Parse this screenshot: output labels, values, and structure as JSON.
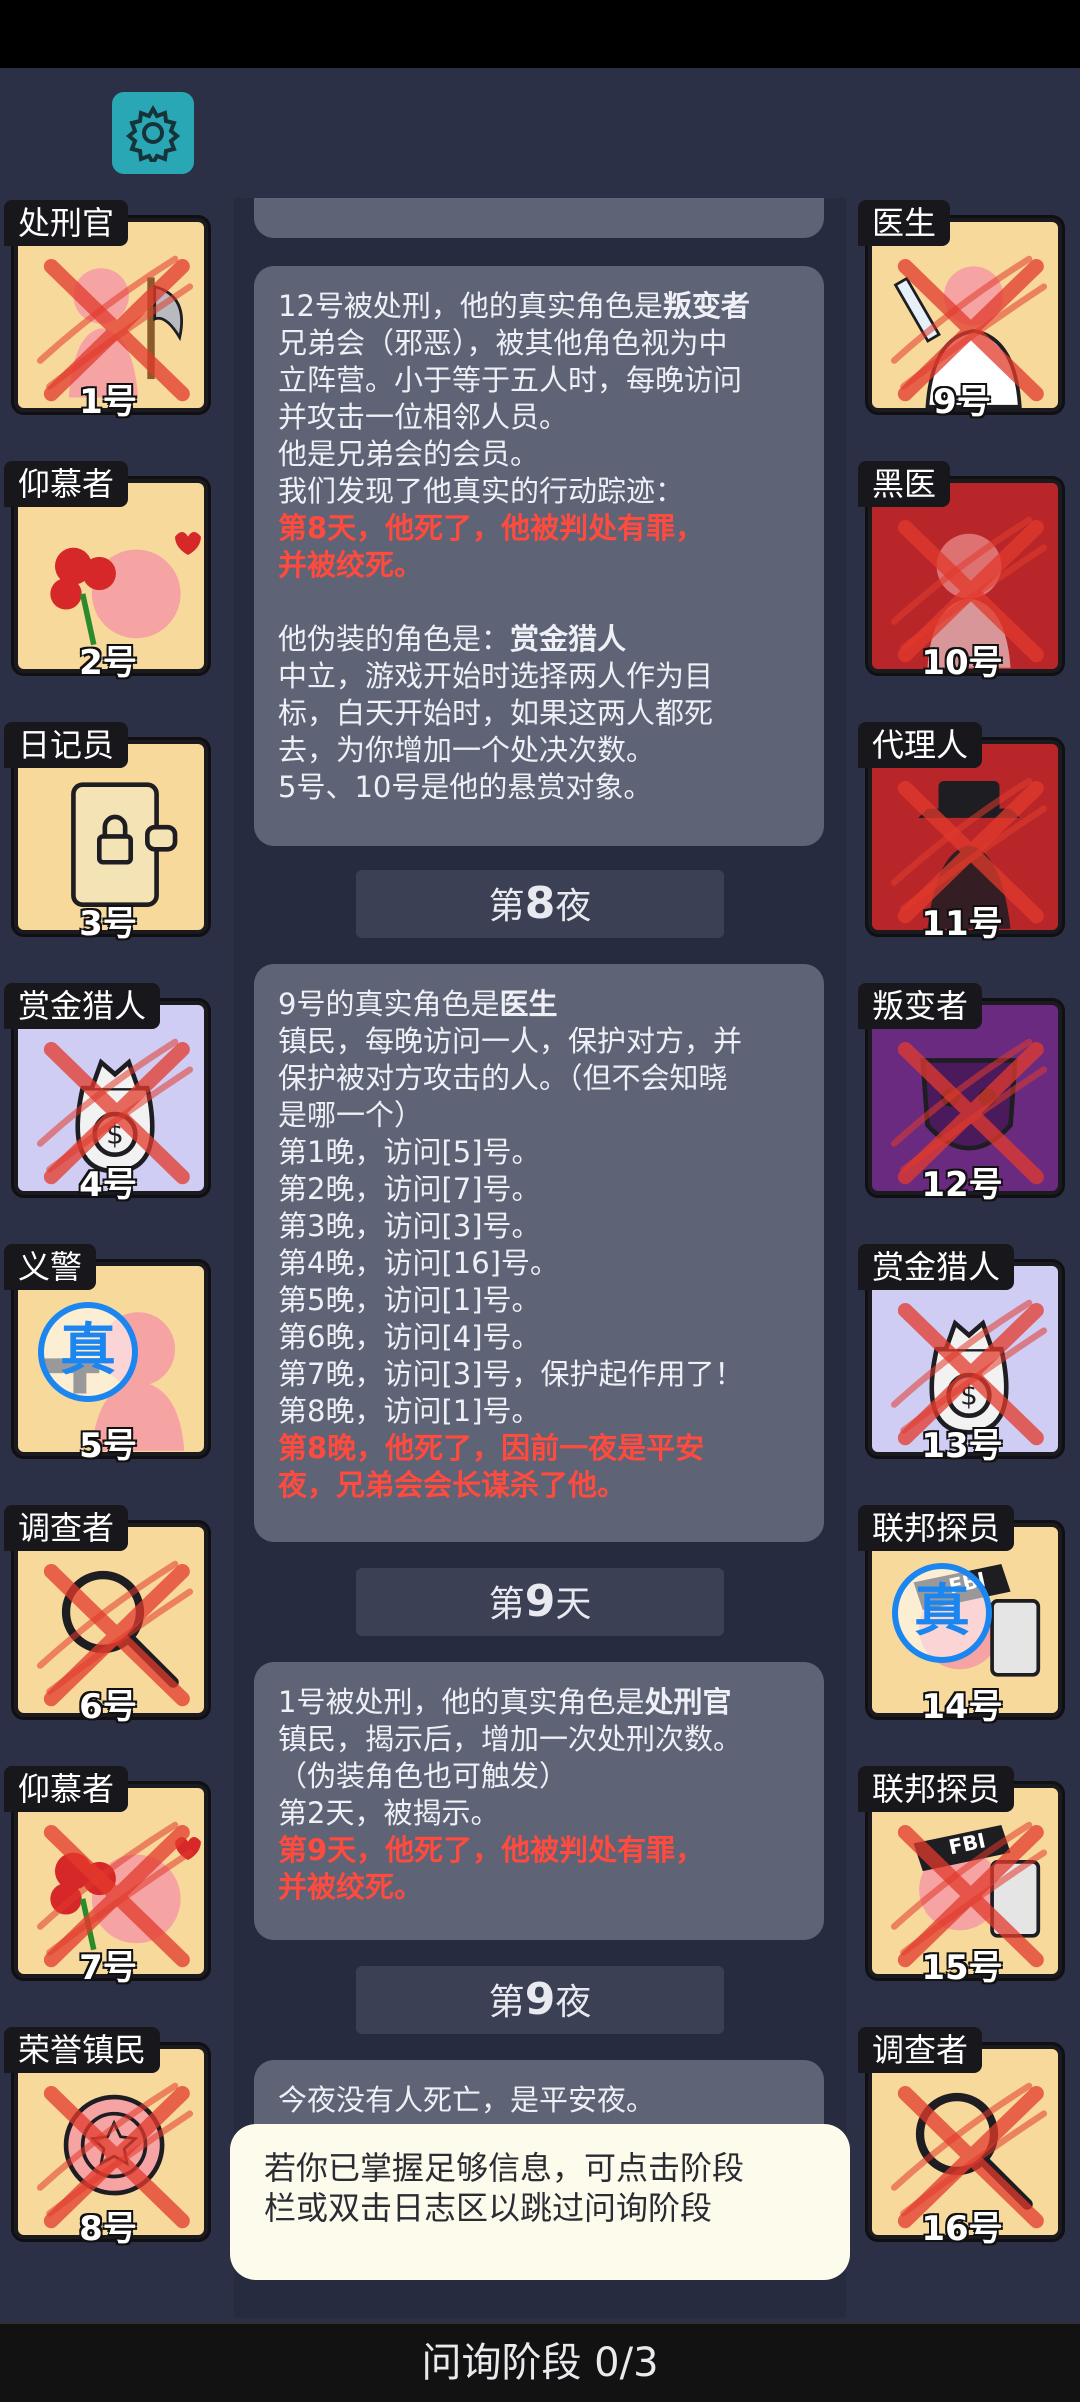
{
  "players_left": [
    {
      "role": "处刑官",
      "number": "1号",
      "color": "#f8d99c",
      "dead": true,
      "true": false,
      "icon": "executioner-axe"
    },
    {
      "role": "仰慕者",
      "number": "2号",
      "color": "#f8d99c",
      "dead": false,
      "true": false,
      "icon": "admirer-roses"
    },
    {
      "role": "日记员",
      "number": "3号",
      "color": "#f8d99c",
      "dead": false,
      "true": false,
      "icon": "diary-lock"
    },
    {
      "role": "赏金猎人",
      "number": "4号",
      "color": "#cfcdf3",
      "dead": true,
      "true": false,
      "icon": "money-bag"
    },
    {
      "role": "义警",
      "number": "5号",
      "color": "#f8d99c",
      "dead": false,
      "true": true,
      "icon": "vigilante-gun"
    },
    {
      "role": "调查者",
      "number": "6号",
      "color": "#f8d99c",
      "dead": true,
      "true": false,
      "icon": "magnifier"
    },
    {
      "role": "仰慕者",
      "number": "7号",
      "color": "#f8d99c",
      "dead": true,
      "true": false,
      "icon": "admirer-roses"
    },
    {
      "role": "荣誉镇民",
      "number": "8号",
      "color": "#f8d99c",
      "dead": true,
      "true": false,
      "icon": "medal"
    }
  ],
  "players_right": [
    {
      "role": "医生",
      "number": "9号",
      "color": "#f8d99c",
      "dead": true,
      "true": false,
      "icon": "doctor-syringe"
    },
    {
      "role": "黑医",
      "number": "10号",
      "color": "#b8262a",
      "dead": true,
      "true": false,
      "icon": "dark-doctor"
    },
    {
      "role": "代理人",
      "number": "11号",
      "color": "#b8262a",
      "dead": true,
      "true": false,
      "icon": "agent-hat"
    },
    {
      "role": "叛变者",
      "number": "12号",
      "color": "#6a2a80",
      "dead": true,
      "true": false,
      "icon": "traitor-mask"
    },
    {
      "role": "赏金猎人",
      "number": "13号",
      "color": "#cfcdf3",
      "dead": true,
      "true": false,
      "icon": "money-bag"
    },
    {
      "role": "联邦探员",
      "number": "14号",
      "color": "#f8d99c",
      "dead": false,
      "true": true,
      "icon": "fbi-agent"
    },
    {
      "role": "联邦探员",
      "number": "15号",
      "color": "#f8d99c",
      "dead": true,
      "true": false,
      "icon": "fbi-agent"
    },
    {
      "role": "调查者",
      "number": "16号",
      "color": "#f8d99c",
      "dead": true,
      "true": false,
      "icon": "magnifier"
    }
  ],
  "true_badge": "真",
  "log": {
    "card1": {
      "l1_pre": "12号被处刑，他的真实角色是",
      "l1_bold": "叛变者",
      "l2": "兄弟会（邪恶），被其他角色视为中",
      "l3": "立阵营。小于等于五人时，每晚访问",
      "l4": "并攻击一位相邻人员。",
      "l5": "他是兄弟会的会员。",
      "l6": "我们发现了他真实的行动踪迹：",
      "l7": "第8天，他死了，他被判处有罪，",
      "l8": "并被绞死。",
      "l9_pre": "他伪装的角色是：",
      "l9_bold": "赏金猎人",
      "l10": "中立，游戏开始时选择两人作为目",
      "l11": "标，白天开始时，如果这两人都死",
      "l12": "去，为你增加一个处决次数。",
      "l13": "5号、10号是他的悬赏对象。"
    },
    "div1": {
      "pre": "第",
      "num": "8",
      "post": "夜"
    },
    "card2": {
      "l1_pre": "9号的真实角色是",
      "l1_bold": "医生",
      "l2": "镇民，每晚访问一人，保护对方，并",
      "l3": "保护被对方攻击的人。（但不会知晓",
      "l4": "是哪一个）",
      "l5": "第1晚，访问[5]号。",
      "l6": "第2晚，访问[7]号。",
      "l7": "第3晚，访问[3]号。",
      "l8": "第4晚，访问[16]号。",
      "l9": "第5晚，访问[1]号。",
      "l10": "第6晚，访问[4]号。",
      "l11": "第7晚，访问[3]号，保护起作用了！",
      "l12": "第8晚，访问[1]号。",
      "l13": "第8晚，他死了，因前一夜是平安",
      "l14": "夜，兄弟会会长谋杀了他。"
    },
    "div2": {
      "pre": "第",
      "num": "9",
      "post": "天"
    },
    "card3": {
      "l1_pre": "1号被处刑，他的真实角色是",
      "l1_bold": "处刑官",
      "l2": "镇民，揭示后，增加一次处刑次数。",
      "l3": "（伪装角色也可触发）",
      "l4": "第2天，被揭示。",
      "l5": "第9天，他死了，他被判处有罪，",
      "l6": "并被绞死。"
    },
    "div3": {
      "pre": "第",
      "num": "9",
      "post": "夜"
    },
    "card4": {
      "l1": "今夜没有人死亡，是平安夜。"
    }
  },
  "toast": {
    "l1": "若你已掌握足够信息，可点击阶段",
    "l2": "栏或双击日志区以跳过问询阶段"
  },
  "phase_bar": "问询阶段 0/3"
}
